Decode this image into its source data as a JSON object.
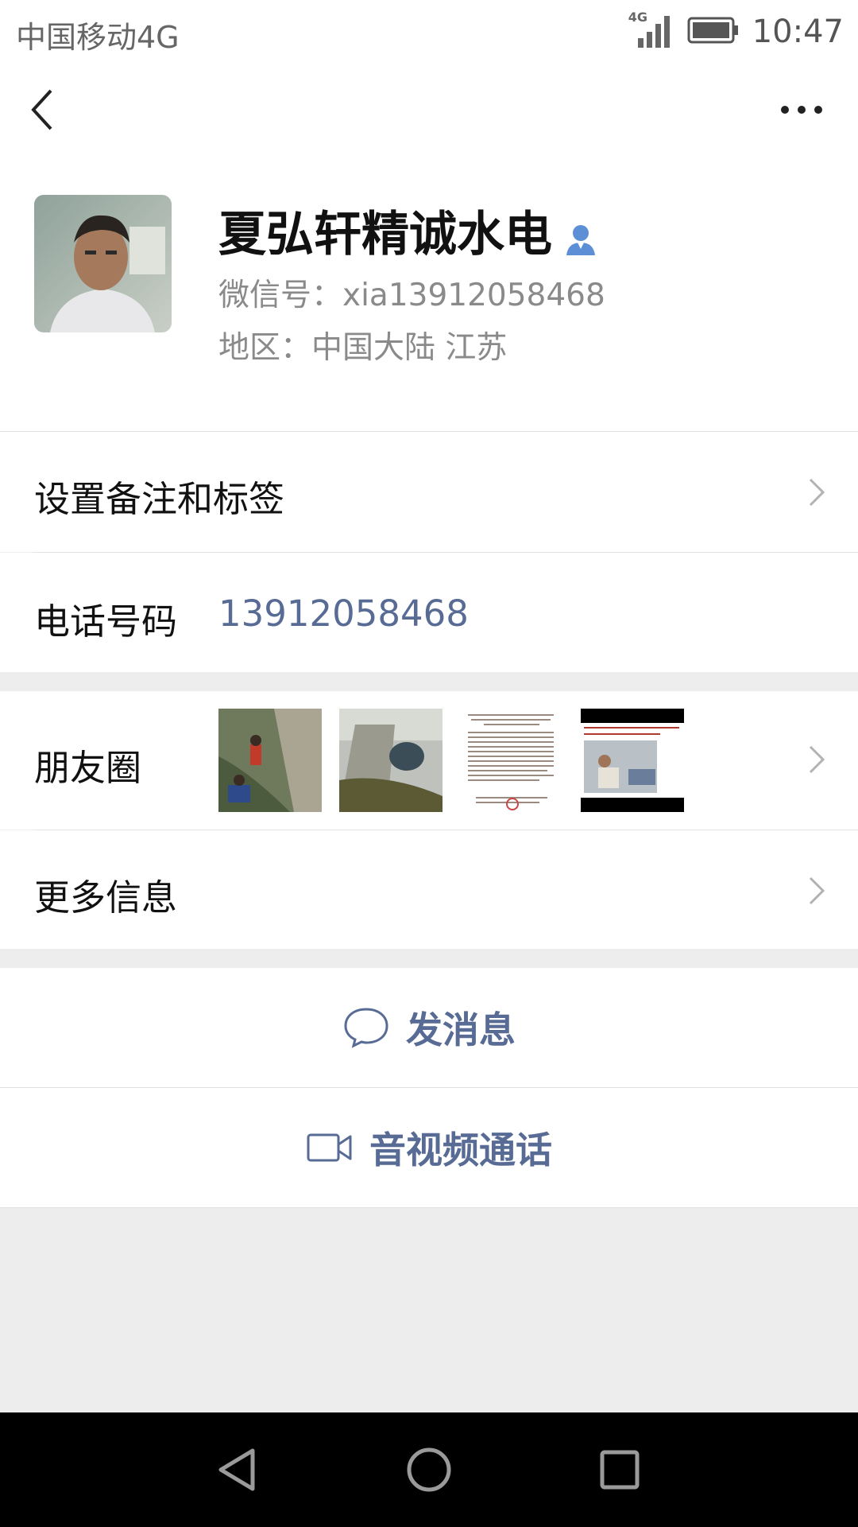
{
  "status_bar": {
    "carrier": "中国移动4G",
    "network_badge": "4G",
    "time": "10:47"
  },
  "profile": {
    "name": "夏弘轩精诚水电",
    "wechat_id": "微信号：xia13912058468",
    "region": "地区：中国大陆  江苏"
  },
  "rows": {
    "remark": "设置备注和标签",
    "phone_label": "电话号码",
    "phone_value": "13912058468",
    "moments": "朋友圈",
    "more_info": "更多信息"
  },
  "actions": {
    "message": "发消息",
    "call": "音视频通话"
  },
  "colors": {
    "link": "#576b95",
    "background": "#ededed"
  },
  "icons": {
    "back": "chevron-left-icon",
    "more": "more-dots-icon",
    "person": "person-icon",
    "chat": "chat-bubble-icon",
    "video": "video-camera-icon"
  }
}
